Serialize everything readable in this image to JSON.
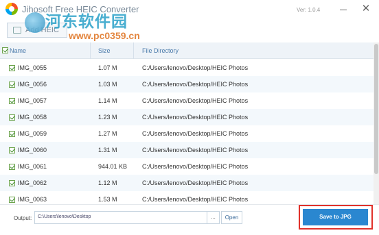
{
  "window": {
    "title": "Jihosoft Free HEIC Converter",
    "version": "Ver: 1.0.4",
    "minimize_label": "",
    "close_label": "✕"
  },
  "watermark": {
    "text": "河东软件园",
    "url": "www.pc0359.cn"
  },
  "toolbar": {
    "add_label": "Add HEIC"
  },
  "table": {
    "columns": [
      "Name",
      "Size",
      "File Directory"
    ],
    "rows": [
      {
        "name": "IMG_0055",
        "size": "1.07 M",
        "dir": "C:/Users/lenovo/Desktop/HEIC Photos",
        "checked": true
      },
      {
        "name": "IMG_0056",
        "size": "1.03 M",
        "dir": "C:/Users/lenovo/Desktop/HEIC Photos",
        "checked": true
      },
      {
        "name": "IMG_0057",
        "size": "1.14 M",
        "dir": "C:/Users/lenovo/Desktop/HEIC Photos",
        "checked": true
      },
      {
        "name": "IMG_0058",
        "size": "1.23 M",
        "dir": "C:/Users/lenovo/Desktop/HEIC Photos",
        "checked": true
      },
      {
        "name": "IMG_0059",
        "size": "1.27 M",
        "dir": "C:/Users/lenovo/Desktop/HEIC Photos",
        "checked": true
      },
      {
        "name": "IMG_0060",
        "size": "1.31 M",
        "dir": "C:/Users/lenovo/Desktop/HEIC Photos",
        "checked": true
      },
      {
        "name": "IMG_0061",
        "size": "944.01 KB",
        "dir": "C:/Users/lenovo/Desktop/HEIC Photos",
        "checked": true
      },
      {
        "name": "IMG_0062",
        "size": "1.12 M",
        "dir": "C:/Users/lenovo/Desktop/HEIC Photos",
        "checked": true
      },
      {
        "name": "IMG_0063",
        "size": "1.53 M",
        "dir": "C:/Users/lenovo/Desktop/HEIC Photos",
        "checked": true
      }
    ]
  },
  "output": {
    "label": "Output:",
    "path": "C:\\Users\\lenovo\\Desktop",
    "browse_label": "...",
    "open_label": "Open"
  },
  "actions": {
    "save_label": "Save to JPG"
  },
  "colors": {
    "accent": "#2a87d0",
    "highlight": "#e0312a",
    "row_alt": "#f3f8fc",
    "check": "#3e8a2a"
  }
}
